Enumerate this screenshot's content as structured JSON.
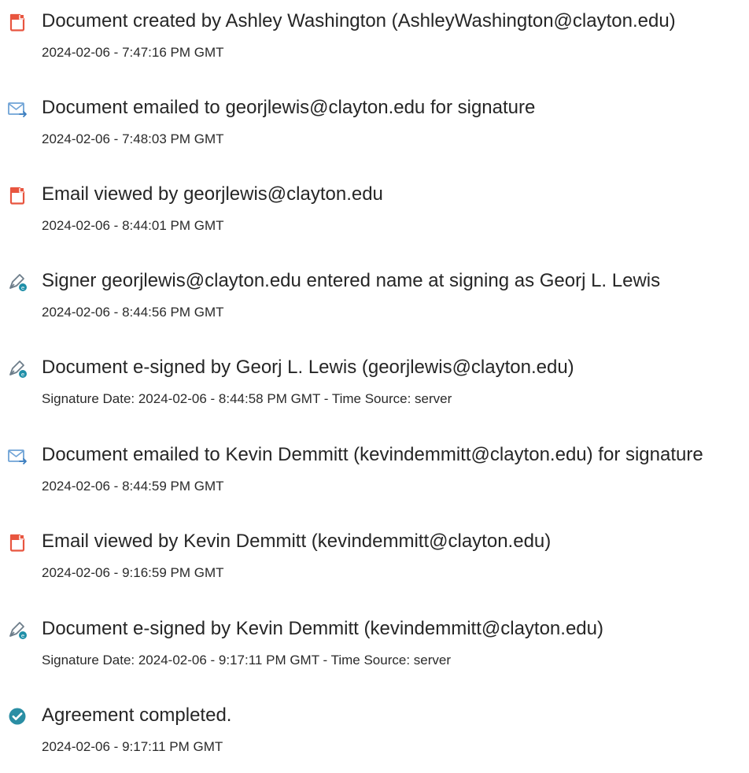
{
  "events": [
    {
      "icon": "document-created-icon",
      "title": "Document created by Ashley Washington (AshleyWashington@clayton.edu)",
      "meta": "2024-02-06 - 7:47:16 PM GMT"
    },
    {
      "icon": "email-sent-icon",
      "title": "Document emailed to georjlewis@clayton.edu for signature",
      "meta": "2024-02-06 - 7:48:03 PM GMT"
    },
    {
      "icon": "email-viewed-icon",
      "title": "Email viewed by georjlewis@clayton.edu",
      "meta": "2024-02-06 - 8:44:01 PM GMT"
    },
    {
      "icon": "signer-pen-icon",
      "title": "Signer georjlewis@clayton.edu entered name at signing as Georj L. Lewis",
      "meta": "2024-02-06 - 8:44:56 PM GMT"
    },
    {
      "icon": "e-sign-pen-icon",
      "title": "Document e-signed by Georj L. Lewis (georjlewis@clayton.edu)",
      "meta": "Signature Date: 2024-02-06 - 8:44:58 PM GMT - Time Source: server"
    },
    {
      "icon": "email-sent-icon",
      "title": "Document emailed to Kevin Demmitt (kevindemmitt@clayton.edu) for signature",
      "meta": "2024-02-06 - 8:44:59 PM GMT"
    },
    {
      "icon": "email-viewed-icon",
      "title": "Email viewed by Kevin Demmitt (kevindemmitt@clayton.edu)",
      "meta": "2024-02-06 - 9:16:59 PM GMT"
    },
    {
      "icon": "e-sign-pen-icon",
      "title": "Document e-signed by Kevin Demmitt (kevindemmitt@clayton.edu)",
      "meta": "Signature Date: 2024-02-06 - 9:17:11 PM GMT - Time Source: server"
    },
    {
      "icon": "check-circle-icon",
      "title": "Agreement completed.",
      "meta": "2024-02-06 - 9:17:11 PM GMT"
    }
  ],
  "colors": {
    "document_red": "#e8553f",
    "email_blue": "#6fa3d6",
    "pen_gray": "#6d7d8a",
    "pen_badge_teal": "#1f8fa8",
    "complete_teal": "#2a8ea4"
  }
}
